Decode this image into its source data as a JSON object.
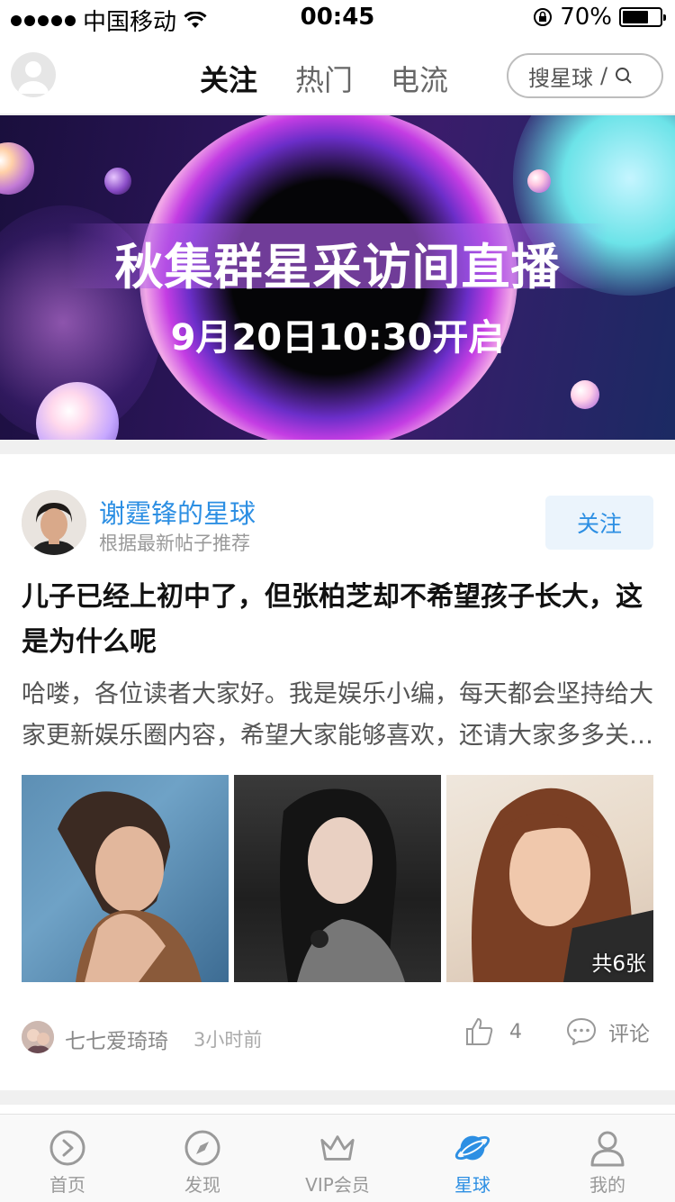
{
  "status_bar": {
    "carrier": "中国移动",
    "time": "00:45",
    "battery_percent": "70%",
    "battery_level": 0.7
  },
  "header": {
    "tabs": [
      {
        "label": "关注",
        "active": true
      },
      {
        "label": "热门",
        "active": false
      },
      {
        "label": "电流",
        "active": false
      }
    ],
    "search_label": "搜星球",
    "search_separator": "/"
  },
  "banner": {
    "title": "秋集群星采访间直播",
    "subtitle": "9月20日10:30开启"
  },
  "post": {
    "channel_name": "谢霆锋的星球",
    "recommend_reason": "根据最新帖子推荐",
    "follow_label": "关注",
    "title": "儿子已经上初中了，但张柏芝却不希望孩子长大，这是为什么呢",
    "excerpt": "哈喽，各位读者大家好。我是娱乐小编，每天都会坚持给大家更新娱乐圈内容，希望大家能够喜欢，还请大家多多关注。",
    "image_count_label": "共6张",
    "author": "七七爱琦琦",
    "time_ago": "3小时前",
    "likes": "4",
    "comment_label": "评论"
  },
  "bottom_nav": [
    {
      "label": "首页",
      "icon": "play-circle-icon",
      "active": false
    },
    {
      "label": "发现",
      "icon": "compass-icon",
      "active": false
    },
    {
      "label": "VIP会员",
      "icon": "crown-icon",
      "active": false
    },
    {
      "label": "星球",
      "icon": "planet-icon",
      "active": true
    },
    {
      "label": "我的",
      "icon": "person-icon",
      "active": false
    }
  ],
  "colors": {
    "accent": "#2d8fe3",
    "follow_bg": "#ebf4fc",
    "separator": "#f0f0f0"
  }
}
